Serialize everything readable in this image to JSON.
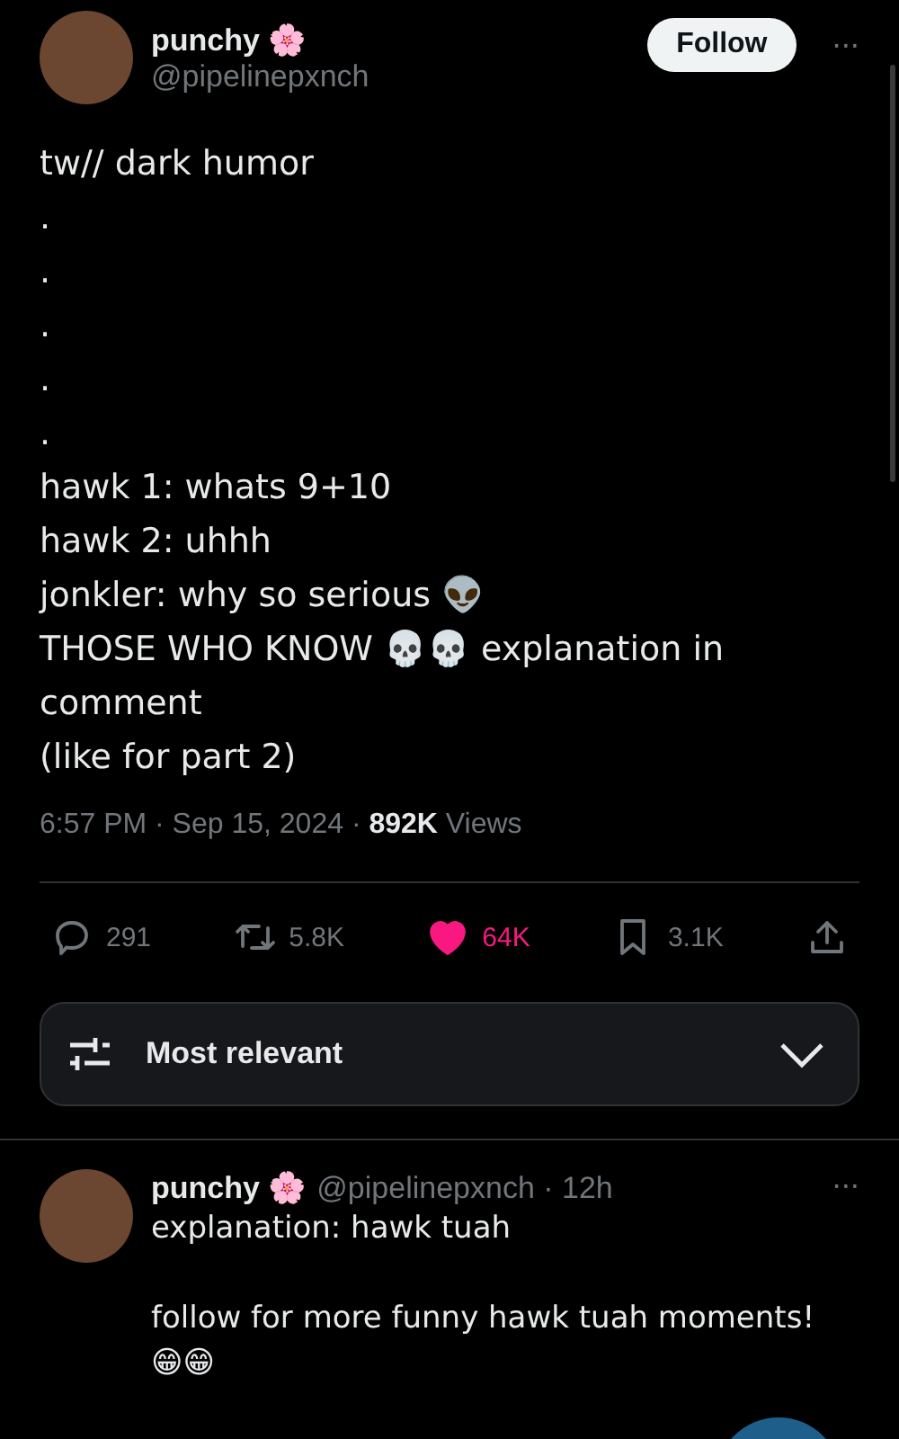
{
  "post": {
    "author": {
      "name": "punchy 🌸",
      "handle": "@pipelinepxnch"
    },
    "follow_button": "Follow",
    "more": "···",
    "lines": [
      "tw// dark humor",
      ".",
      ".",
      ".",
      ".",
      ".",
      "hawk 1: whats 9+10",
      "hawk 2: uhhh",
      "jonkler: why so serious 👽",
      "THOSE WHO KNOW 💀💀 explanation in comment",
      "(like for part 2)"
    ],
    "time": "6:57 PM · Sep 15, 2024 · ",
    "views_count": "892K",
    "views_label": " Views",
    "actions": [
      {
        "kind": "reply",
        "count": "291",
        "selected": false
      },
      {
        "kind": "repost",
        "count": "5.8K",
        "selected": false
      },
      {
        "kind": "like",
        "count": "64K",
        "selected": true
      },
      {
        "kind": "bookmark",
        "count": "3.1K",
        "selected": false
      },
      {
        "kind": "share"
      }
    ]
  },
  "sort": {
    "label": "Most relevant"
  },
  "reply": {
    "author": {
      "name": "punchy 🌸",
      "handle": "@pipelinepxnch",
      "time": " · 12h"
    },
    "more": "···",
    "text": "explanation: hawk tuah\n\nfollow for more funny hawk tuah moments!\n😁😁"
  }
}
